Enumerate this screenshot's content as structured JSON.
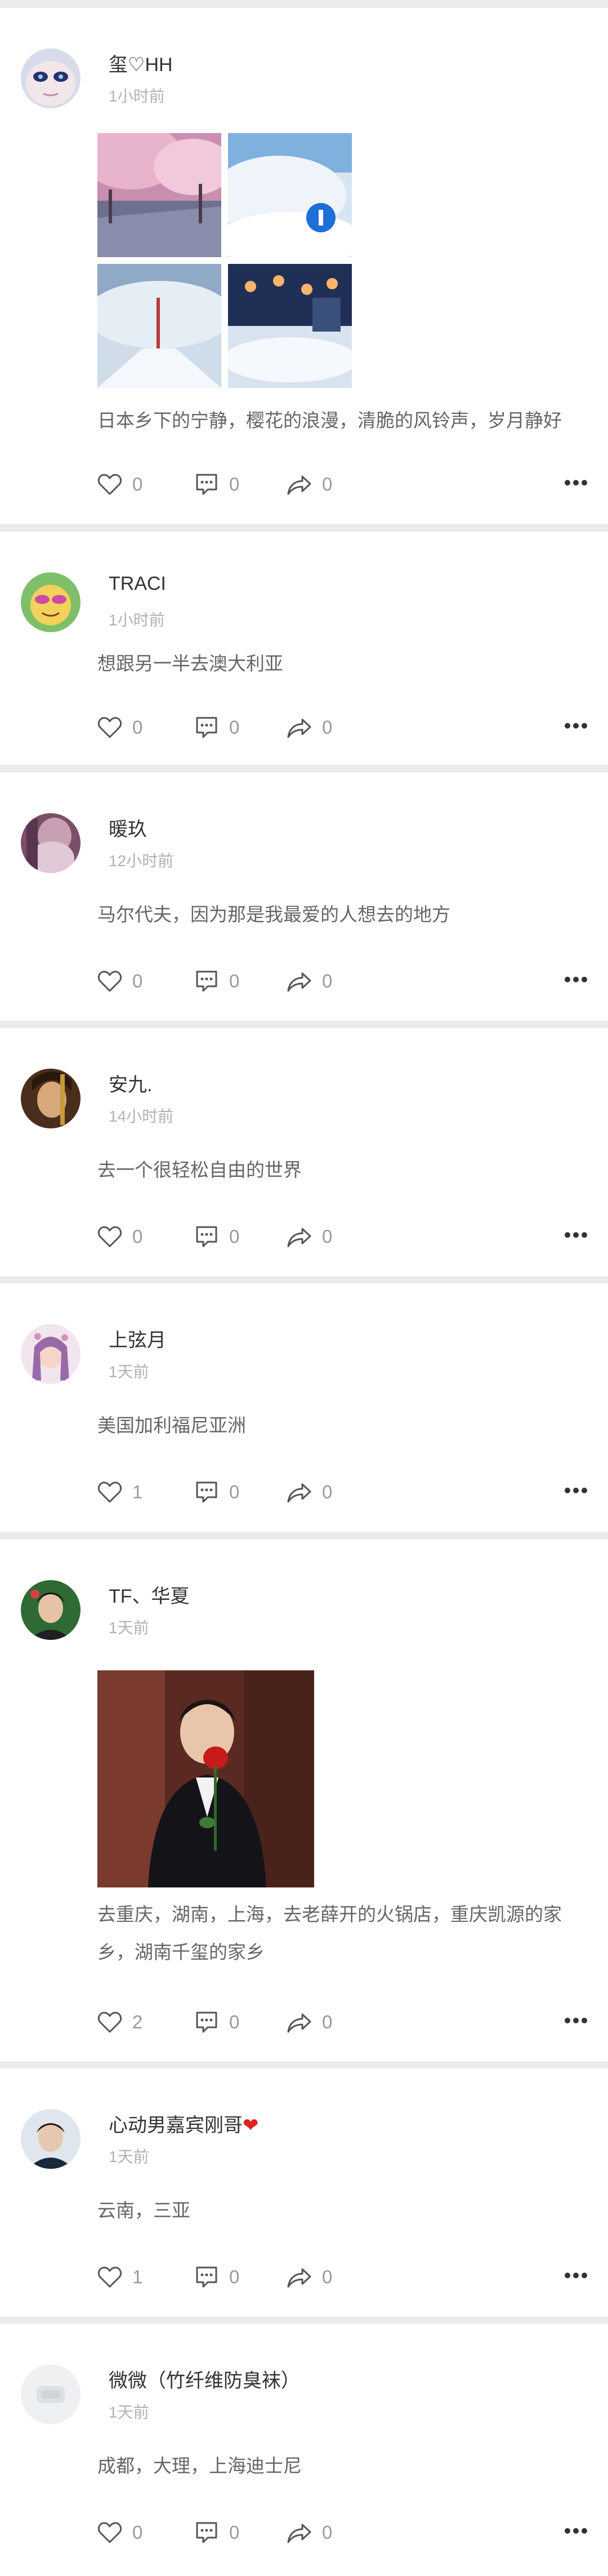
{
  "posts": [
    {
      "username": "玺♡HH",
      "time": "1小时前",
      "text": "日本乡下的宁静，樱花的浪漫，清脆的风铃声，岁月静好",
      "likes": "0",
      "comments": "0",
      "shares": "0"
    },
    {
      "username": "TRACI",
      "time": "1小时前",
      "text": "想跟另一半去澳大利亚",
      "likes": "0",
      "comments": "0",
      "shares": "0"
    },
    {
      "username": "暖玖",
      "time": "12小时前",
      "text": "马尔代夫，因为那是我最爱的人想去的地方",
      "likes": "0",
      "comments": "0",
      "shares": "0"
    },
    {
      "username": "安九.",
      "time": "14小时前",
      "text": "去一个很轻松自由的世界",
      "likes": "0",
      "comments": "0",
      "shares": "0"
    },
    {
      "username": "上弦月",
      "time": "1天前",
      "text": "美国加利福尼亚洲",
      "likes": "1",
      "comments": "0",
      "shares": "0"
    },
    {
      "username": "TF、华夏",
      "time": "1天前",
      "text": "去重庆，湖南，上海，去老薛开的火锅店，重庆凯源的家乡，湖南千玺的家乡",
      "likes": "2",
      "comments": "0",
      "shares": "0"
    },
    {
      "username": "心动男嘉宾刚哥",
      "username_emoji": "❤",
      "time": "1天前",
      "text": "云南，三亚",
      "likes": "1",
      "comments": "0",
      "shares": "0"
    },
    {
      "username": "微微（竹纤维防臭袜）",
      "time": "1天前",
      "text": "成都，大理，上海迪士尼",
      "likes": "0",
      "comments": "0",
      "shares": "0"
    }
  ],
  "icons": {
    "like": "heart-outline-icon",
    "comment": "speech-bubble-icon",
    "share": "share-arrow-icon",
    "more": "more-dots-icon"
  },
  "colors": {
    "page_background": "#ebebeb",
    "card_background": "#ffffff",
    "username": "#333333",
    "timestamp": "#b2b2b2",
    "body_text": "#666666",
    "action_count": "#999999",
    "heart_emoji": "#e02020"
  }
}
